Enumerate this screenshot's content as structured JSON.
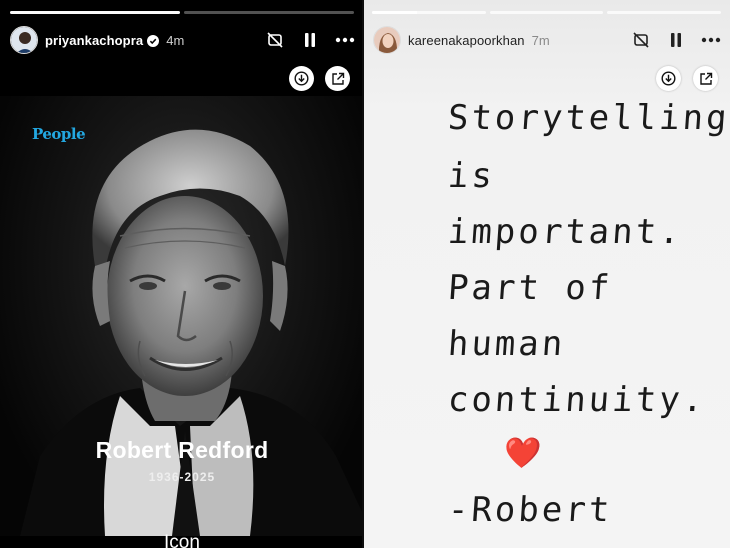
{
  "left_story": {
    "progress": [
      1.0,
      0.0
    ],
    "username": "priyankachopra",
    "time": "4m",
    "brand": "People",
    "title": "Robert Redford",
    "years": "1936-2025",
    "caption": "Icon"
  },
  "right_story": {
    "progress": [
      0.4,
      0.0,
      0.0
    ],
    "username": "kareenakapoorkhan",
    "time": "7m",
    "note_lines": [
      "Storytelling",
      "is",
      "important.",
      "Part of",
      "human",
      "continuity.",
      "-Robert"
    ],
    "heart": "❤️"
  },
  "icons": {
    "verified": "verified-badge-icon",
    "muted": "speaker-muted-icon",
    "pause": "pause-icon",
    "more": "more-options-icon",
    "download": "download-icon",
    "share": "share-external-icon"
  },
  "colors": {
    "people_brand": "#23a7e0",
    "verified_badge": "#ffffff"
  }
}
